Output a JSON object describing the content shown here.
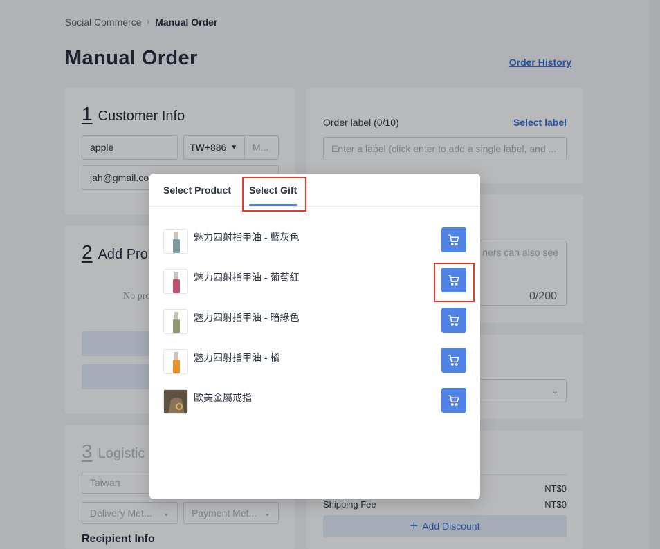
{
  "breadcrumb": {
    "root": "Social Commerce",
    "current": "Manual Order"
  },
  "page_title": "Manual Order",
  "order_history_link": "Order History",
  "customer_info": {
    "number": "1",
    "title": "Customer Info",
    "name_value": "apple",
    "country_code": "TW",
    "dial_code": "+886",
    "mobile_placeholder": "M...",
    "email_value": "jah@gmail.co"
  },
  "add_products": {
    "number": "2",
    "title": "Add Pro",
    "empty_text": "No pro"
  },
  "logistics": {
    "number": "3",
    "title": "Logistic",
    "country_placeholder": "Taiwan",
    "delivery_placeholder": "Delivery Met...",
    "payment_placeholder": "Payment Met...",
    "recipient_title": "Recipient Info"
  },
  "order_label": {
    "title": "Order label (0/10)",
    "select_label": "Select label",
    "input_placeholder": "Enter a label (click enter to add a single label, and ..."
  },
  "remarks": {
    "placeholder_fragment": "ners can also see",
    "counter": "0/200"
  },
  "summary": {
    "subtotal_value": "NT$0",
    "shipping_label": "Shipping Fee",
    "shipping_value": "NT$0",
    "add_discount": "Add Discount"
  },
  "modal": {
    "tabs": [
      {
        "label": "Select Product",
        "active": false
      },
      {
        "label": "Select Gift",
        "active": true
      }
    ],
    "products": [
      {
        "name": "魅力四射指甲油 - 藍灰色",
        "icon": "cart-icon",
        "color": "#7f9aa0"
      },
      {
        "name": "魅力四射指甲油 - 葡萄紅",
        "icon": "cart-icon",
        "color": "#c0506e"
      },
      {
        "name": "魅力四射指甲油 - 暗綠色",
        "icon": "cart-icon",
        "color": "#8f9a6e"
      },
      {
        "name": "魅力四射指甲油 - 橘",
        "icon": "cart-icon",
        "color": "#e8902a"
      },
      {
        "name": "歐美金屬戒指",
        "icon": "cart-icon",
        "color": "#6b5a40"
      }
    ]
  },
  "colors": {
    "accent": "#4f84e6",
    "link": "#2f6fd6",
    "highlight": "#e53b25"
  }
}
